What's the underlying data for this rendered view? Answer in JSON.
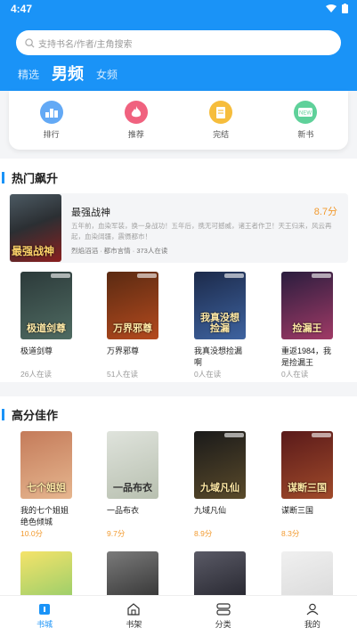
{
  "status": {
    "time": "4:47"
  },
  "search": {
    "placeholder": "支持书名/作者/主角搜索"
  },
  "top_tabs": [
    {
      "label": "精选",
      "active": false
    },
    {
      "label": "男频",
      "active": true
    },
    {
      "label": "女频",
      "active": false
    }
  ],
  "categories": [
    {
      "label": "排行",
      "icon": "ranking-icon",
      "color": "#63a9f5"
    },
    {
      "label": "推荐",
      "icon": "flame-icon",
      "color": "#f0627f"
    },
    {
      "label": "完结",
      "icon": "finished-book-icon",
      "color": "#f6bd3c"
    },
    {
      "label": "新书",
      "icon": "new-book-icon",
      "color": "#5fd19a"
    }
  ],
  "hot_section": {
    "title": "热门飙升",
    "featured": {
      "title": "最强战神",
      "cover_text": "最强战神",
      "score": "8.7分",
      "description": "五年前，血染军装，换一身战功！五年后，携无可撼威，诸王者作卫！天王归来，风云再起，血染阔疆，震慑都市！",
      "meta": "烈焰滔滔 · 都市言情 · 373人在读"
    },
    "books": [
      {
        "title": "极道剑尊",
        "cover_text": "极道剑尊",
        "stat": "26人在读",
        "cover": [
          "#2c3a3a",
          "#4f6b62"
        ]
      },
      {
        "title": "万界邪尊",
        "cover_text": "万界邪尊",
        "stat": "51人在读",
        "cover": [
          "#5a2a12",
          "#b44a1e"
        ]
      },
      {
        "title": "我真没想捡漏啊",
        "cover_text": "我真没想捡漏",
        "stat": "0人在读",
        "cover": [
          "#1c2a4a",
          "#3e63a0"
        ]
      },
      {
        "title": "重返1984，我是捡漏王",
        "cover_text": "捡漏王",
        "stat": "0人在读",
        "cover": [
          "#2a1d3e",
          "#a03a66"
        ]
      }
    ]
  },
  "high_section": {
    "title": "高分佳作",
    "books": [
      {
        "title": "我的七个姐姐绝色倾城",
        "cover_text": "七个姐姐",
        "score": "10.0分",
        "cover": [
          "#c47b5a",
          "#e6b68f"
        ]
      },
      {
        "title": "一品布衣",
        "cover_text": "一品布衣",
        "score": "9.7分",
        "cover": [
          "#dfe3dc",
          "#b8c0b0"
        ]
      },
      {
        "title": "九域凡仙",
        "cover_text": "九域凡仙",
        "score": "8.9分",
        "cover": [
          "#1a1a1a",
          "#5a4a2a"
        ]
      },
      {
        "title": "谋断三国",
        "cover_text": "谋断三国",
        "score": "8.3分",
        "cover": [
          "#5a1a1a",
          "#a04a2a"
        ]
      }
    ]
  },
  "bottom_nav": [
    {
      "label": "书城",
      "icon": "bookstore-icon",
      "active": true
    },
    {
      "label": "书架",
      "icon": "bookshelf-icon",
      "active": false
    },
    {
      "label": "分类",
      "icon": "category-icon",
      "active": false
    },
    {
      "label": "我的",
      "icon": "profile-icon",
      "active": false
    }
  ],
  "colors": {
    "accent": "#1a93f7",
    "score": "#f29a2e"
  }
}
